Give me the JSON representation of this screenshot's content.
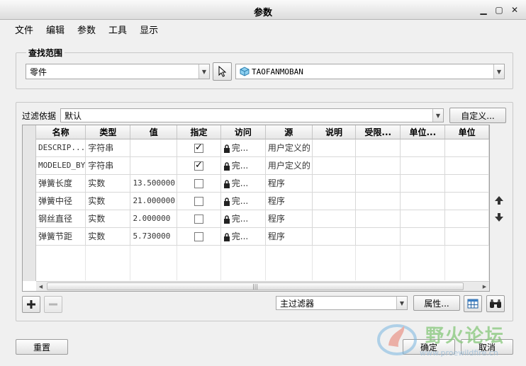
{
  "window": {
    "title": "参数"
  },
  "menu": [
    "文件",
    "编辑",
    "参数",
    "工具",
    "显示"
  ],
  "scope": {
    "label": "查找范围",
    "type_value": "零件",
    "model_value": "TAOFANMOBAN"
  },
  "filter": {
    "label": "过滤依据",
    "value": "默认",
    "customize_label": "自定义..."
  },
  "table": {
    "columns": [
      "名称",
      "类型",
      "值",
      "指定",
      "访问",
      "源",
      "说明",
      "受限...",
      "单位...",
      "单位"
    ],
    "rows": [
      {
        "name": "DESCRIP...",
        "type": "字符串",
        "value": "",
        "designated": true,
        "access": "完...",
        "source": "用户定义的"
      },
      {
        "name": "MODELED_BY",
        "type": "字符串",
        "value": "",
        "designated": true,
        "access": "完...",
        "source": "用户定义的"
      },
      {
        "name": "弹簧长度",
        "type": "实数",
        "value": "13.500000",
        "designated": false,
        "access": "完...",
        "source": "程序"
      },
      {
        "name": "弹簧中径",
        "type": "实数",
        "value": "21.000000",
        "designated": false,
        "access": "完...",
        "source": "程序"
      },
      {
        "name": "钢丝直径",
        "type": "实数",
        "value": "2.000000",
        "designated": false,
        "access": "完...",
        "source": "程序"
      },
      {
        "name": "弹簧节距",
        "type": "实数",
        "value": "5.730000",
        "designated": false,
        "access": "完...",
        "source": "程序"
      }
    ]
  },
  "bottom": {
    "main_filter": "主过滤器",
    "properties_label": "属性...",
    "reset_label": "重置",
    "ok_label": "确定",
    "cancel_label": "取消"
  },
  "watermark": {
    "text": "野火论坛",
    "url": "www.proewildfire.cn"
  }
}
